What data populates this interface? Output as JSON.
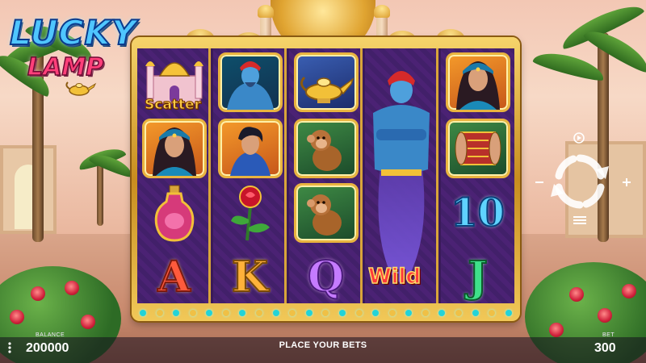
{
  "game": {
    "logo_line1": "LUCKY",
    "logo_line2": "LAMP"
  },
  "reels": [
    {
      "symbols": [
        {
          "type": "scatter",
          "label": "Scatter",
          "icon": "palace-icon"
        },
        {
          "type": "princess",
          "icon": "princess-icon"
        },
        {
          "type": "potion",
          "icon": "potion-bottle-icon"
        },
        {
          "type": "letter",
          "label": "A"
        }
      ]
    },
    {
      "symbols": [
        {
          "type": "genie",
          "icon": "genie-icon"
        },
        {
          "type": "prince",
          "icon": "prince-icon"
        },
        {
          "type": "rose",
          "icon": "rose-icon"
        },
        {
          "type": "letter",
          "label": "K"
        }
      ]
    },
    {
      "symbols": [
        {
          "type": "lamp",
          "icon": "magic-lamp-icon"
        },
        {
          "type": "monkey",
          "icon": "monkey-icon"
        },
        {
          "type": "monkey",
          "icon": "monkey-icon"
        },
        {
          "type": "letter",
          "label": "Q"
        }
      ]
    },
    {
      "symbols": [
        {
          "type": "wild",
          "label": "Wild",
          "icon": "genie-icon",
          "expanded": true
        }
      ]
    },
    {
      "symbols": [
        {
          "type": "princess",
          "icon": "princess-icon"
        },
        {
          "type": "scroll",
          "icon": "carpet-scroll-icon"
        },
        {
          "type": "letter",
          "label": "10"
        },
        {
          "type": "letter",
          "label": "J"
        }
      ]
    }
  ],
  "controls": {
    "spin_icon": "spin-arrows-icon",
    "autoplay_icon": "autoplay-icon",
    "menu_icon": "hamburger-menu-icon"
  },
  "bottom_bar": {
    "balance_label": "BALANCE",
    "balance_value": "200000",
    "status": "PLACE YOUR BETS",
    "bet_label": "BET",
    "bet_value": "300"
  },
  "colors": {
    "frame_gold": "#d9a53a",
    "reel_purple": "#4b2274",
    "logo_blue": "#4fc6ff",
    "logo_pink": "#ff3f7a"
  }
}
